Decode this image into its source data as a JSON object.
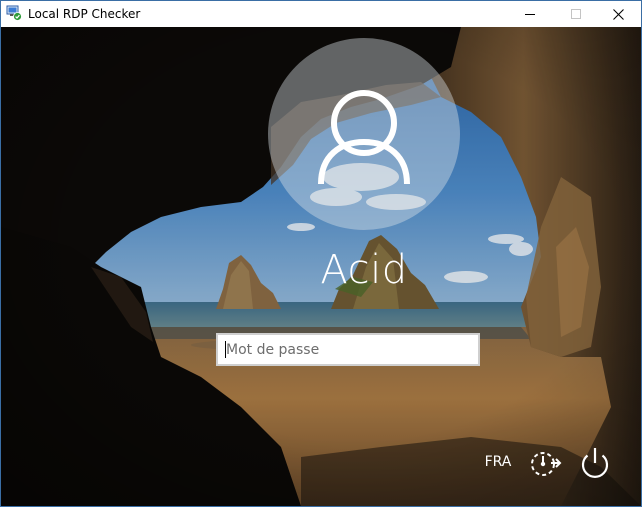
{
  "window": {
    "title": "Local RDP Checker",
    "controls": {
      "minimize_icon": "minimize-icon",
      "maximize_icon": "maximize-icon",
      "close_icon": "close-icon"
    },
    "app_icon": "rdp-checker-app-icon",
    "border_color": "#3a6ea5"
  },
  "login": {
    "avatar_icon": "user-silhouette-icon",
    "username": "Acid",
    "password": {
      "value": "",
      "placeholder": "Mot de passe"
    }
  },
  "bottom_bar": {
    "language": "FRA",
    "ease_of_access_icon": "ease-of-access-icon",
    "power_icon": "power-icon"
  },
  "background": {
    "scene": "sea-cave-beach-wallpaper",
    "sky_color": "#2f6fb3",
    "sand_color": "#a4743f"
  }
}
